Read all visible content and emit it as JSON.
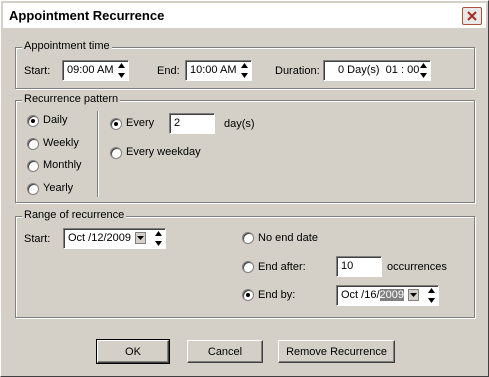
{
  "window": {
    "title": "Appointment Recurrence"
  },
  "appointment_time": {
    "legend": "Appointment time",
    "start_label": "Start:",
    "start_value": "09:00 AM",
    "end_label": "End:",
    "end_value": "10:00 AM",
    "duration_label": "Duration:",
    "duration_value": "0 Day(s)  01 : 00"
  },
  "recurrence_pattern": {
    "legend": "Recurrence pattern",
    "options": [
      {
        "label": "Daily",
        "checked": true
      },
      {
        "label": "Weekly",
        "checked": false
      },
      {
        "label": "Monthly",
        "checked": false
      },
      {
        "label": "Yearly",
        "checked": false
      }
    ],
    "every_label": "Every",
    "every_value": "2",
    "every_unit": "day(s)",
    "every_weekday_label": "Every weekday"
  },
  "range": {
    "legend": "Range of recurrence",
    "start_label": "Start:",
    "start_value": "Oct /12/2009",
    "no_end_label": "No end date",
    "end_after_label": "End after:",
    "end_after_value": "10",
    "occurrences_label": "occurrences",
    "end_by_label": "End by:",
    "end_by_value_prefix": "Oct /16/",
    "end_by_value_selected": "2009"
  },
  "buttons": {
    "ok": "OK",
    "cancel": "Cancel",
    "remove": "Remove Recurrence"
  },
  "icons": {
    "close": "close-icon",
    "spin": "spinner-arrows-icon",
    "dropdown": "dropdown-arrow-icon"
  }
}
